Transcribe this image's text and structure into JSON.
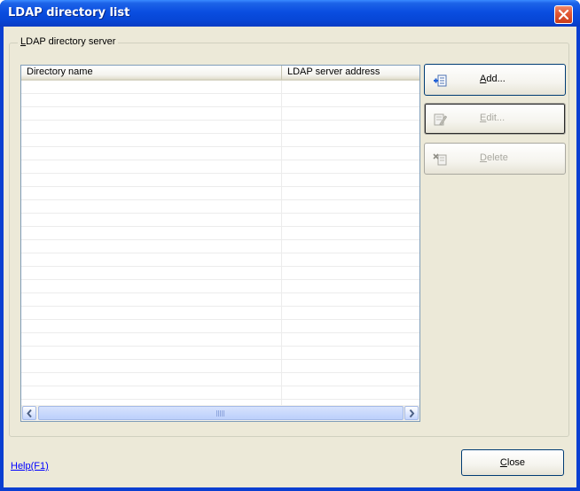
{
  "window": {
    "title": "LDAP directory list"
  },
  "group": {
    "legend": "LDAP directory server"
  },
  "list": {
    "columns": [
      "Directory name",
      "LDAP server address"
    ],
    "rows": []
  },
  "buttons": {
    "add": {
      "mnemonic": "A",
      "rest": "dd...",
      "enabled": true,
      "icon": "add-entry-icon"
    },
    "edit": {
      "mnemonic": "E",
      "rest": "dit...",
      "enabled": false,
      "icon": "edit-entry-icon"
    },
    "delete": {
      "mnemonic": "D",
      "rest": "elete",
      "enabled": false,
      "icon": "delete-entry-icon"
    },
    "close": {
      "mnemonic": "C",
      "rest": "lose"
    }
  },
  "help": {
    "label": "Help(F1)"
  },
  "colors": {
    "title_bar": "#0a4ee0",
    "dialog_bg": "#ece9d8",
    "close_red": "#e35a36",
    "link": "#0000ff"
  }
}
